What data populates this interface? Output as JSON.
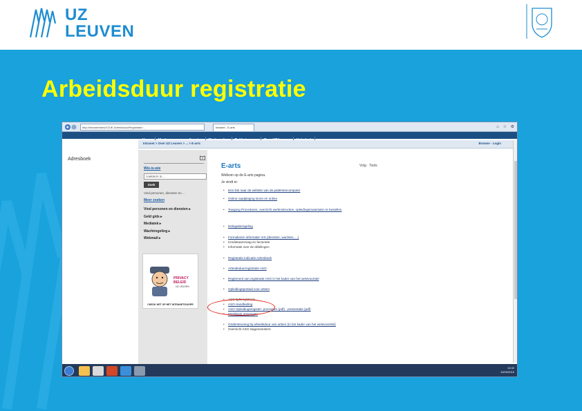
{
  "logo": {
    "line1": "UZ",
    "line2": "LEUVEN",
    "brand_color": "#1d8dd0"
  },
  "slide": {
    "title": "Arbeidsduur registratie",
    "title_color": "#ffff00",
    "bg_color": "#19a2dc"
  },
  "browser": {
    "address": "http://intranet/sites/VZUE-ArbeidsduurRegistratie/...",
    "tab_label": "Intranet - E-arts",
    "toolbar_icons": [
      "home-icon",
      "star-icon",
      "gear-icon"
    ]
  },
  "site_nav": [
    "Home",
    "Vind personen en diensten",
    "Medewerker",
    "Patiëntenzorg",
    "Over UZ Leuven",
    "Helpdesk"
  ],
  "breadcrumb": {
    "path": "Intranet > Over UZ Leuven > ... > E-arts",
    "right": "Browse · Login"
  },
  "sidebar": {
    "title": "Adresboek",
    "who_is_who": "Wie-is-wie",
    "search_placeholder": "zoekterm in...",
    "search_button": "Zoek",
    "note": "Vind personen, diensten en ...",
    "search_more": "Meer zoeken",
    "menu": [
      "Vind personen en diensten ▸",
      "Geld gids ▸",
      "Mediatek ▸",
      "Wachtregeling ▸",
      "Webmail ▸"
    ],
    "ad": {
      "brand": "PRIVACY BELEID",
      "sub": "UZ LEUVEN",
      "caption": "CHECK HET OP HET INTRANET/SUGPR"
    }
  },
  "page": {
    "heading": "E-arts",
    "actions": "Volg · Tools",
    "intro": "Welkom op de E-arts pagina.",
    "intro2": "Je vindt er:",
    "links": [
      "Een link naar de website van de patiëntencomputer",
      "Online raadpleging lonen en online",
      "Toegang Procedures, overzicht werkinstructies, opleidingsmaterialen te bestellen",
      "Delegatieregeling",
      "Formulieren informatie VIS (diensten, wachten, ...)",
      "Kredietaanvraag en facturatie",
      "Informatie over de afdelingen",
      "Registratie indicatie Adresboek",
      "Arbeidsduurregistratie ASO",
      "Reglement van registratie ASO in het kader van het wetsvoorstel",
      "Opleidingsportaal voor artsen",
      "ASO tijdsregistratie",
      "ASO Handleiding",
      "ASO Opleidingsregister: procedure (pdf) - presentatie (pdf)",
      "Feedback ontvangen",
      "Ondersteuning bij arbeidsduur van artsen (in het kader van het wetsvoorstel)",
      "Overzicht ASO stagemeesters"
    ]
  },
  "taskbar": {
    "time": "14:32",
    "date": "10/03/2016"
  }
}
